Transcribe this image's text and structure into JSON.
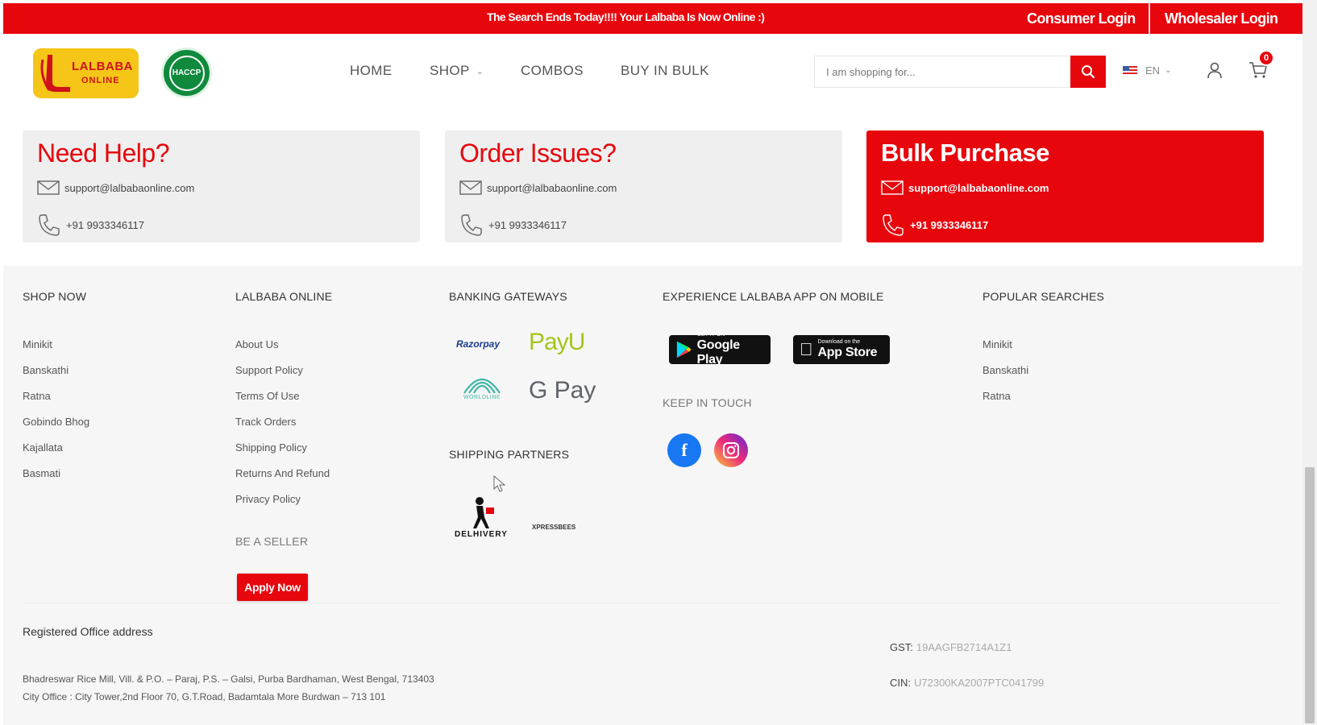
{
  "topbar": {
    "promo_text": "The Search Ends Today!!!! Your Lalbaba Is Now Online :)",
    "consumer_login": "Consumer Login",
    "wholesaler_login": "Wholesaler Login",
    "bg_color": "#e8060d"
  },
  "header": {
    "logo_text_1": "LALBABA",
    "logo_text_2": "ONLINE",
    "badge_text": "HACCP",
    "nav": {
      "home": "HOME",
      "shop": "SHOP",
      "combos": "COMBOS",
      "buy_in_bulk": "BUY IN BULK"
    },
    "search_placeholder": "I am shopping for...",
    "language": "EN",
    "cart_count": "0"
  },
  "help_cards": [
    {
      "title": "Need Help?",
      "email": "support@lalbabaonline.com",
      "phone": "+91 9933346117"
    },
    {
      "title": "Order Issues?",
      "email": "support@lalbabaonline.com",
      "phone": "+91 9933346117"
    },
    {
      "title": "Bulk Purchase",
      "email": "support@lalbabaonline.com",
      "phone": "+91 9933346117"
    }
  ],
  "footer": {
    "shop_now": {
      "title": "SHOP NOW",
      "items": [
        "Minikit",
        "Banskathi",
        "Ratna",
        "Gobindo Bhog",
        "Kajallata",
        "Basmati"
      ]
    },
    "lalbaba_online": {
      "title": "LALBABA ONLINE",
      "items": [
        "About Us",
        "Support Policy",
        "Terms Of Use",
        "Track Orders",
        "Shipping Policy",
        "Returns And Refund",
        "Privacy Policy"
      ],
      "be_a_seller": "BE A SELLER",
      "apply_now": "Apply Now"
    },
    "banking": {
      "title": "BANKING GATEWAYS",
      "razorpay": "Razorpay",
      "payu": "PayU",
      "worldline": "WORLDLINE",
      "gpay": "G Pay"
    },
    "shipping": {
      "title": "SHIPPING PARTNERS",
      "delhivery": "DELHIVERY",
      "xpressbees": "XPRESSBEES"
    },
    "app": {
      "title": "EXPERIENCE LALBABA APP ON MOBILE",
      "google_small": "GET IT ON",
      "google_big": "Google Play",
      "apple_small": "Download on the",
      "apple_big": "App Store",
      "keep_in_touch": "KEEP IN TOUCH"
    },
    "popular": {
      "title": "POPULAR SEARCHES",
      "items": [
        "Minikit",
        "Banskathi",
        "Ratna"
      ]
    },
    "office": {
      "title": "Registered Office address",
      "line1": "Bhadreswar Rice Mill, Vill. & P.O. – Paraj, P.S. – Galsi, Purba Bardhaman, West Bengal, 713403",
      "line2": "City Office : City Tower,2nd Floor 70, G.T.Road, Badamtala More Burdwan – 713 101",
      "gst_label": "GST:",
      "gst_value": "19AAGFB2714A1Z1",
      "cin_label": "CIN:",
      "cin_value": "U72300KA2007PTC041799"
    }
  }
}
